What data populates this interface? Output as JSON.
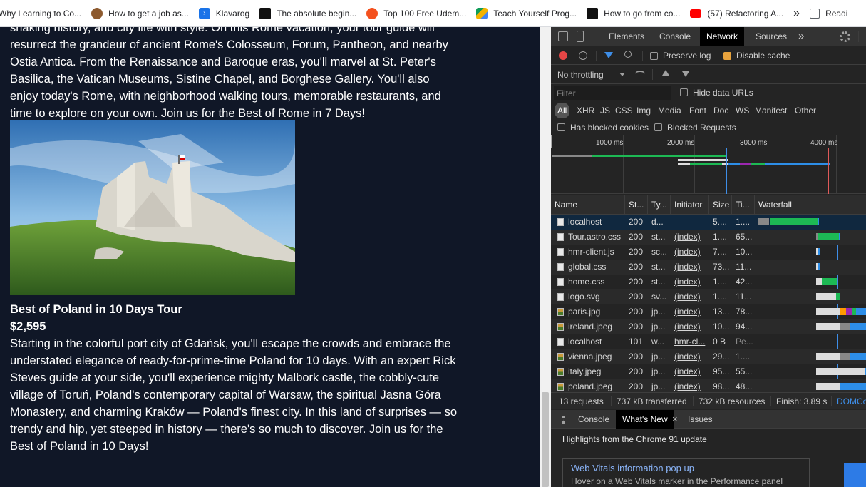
{
  "bookmarks": [
    {
      "label": "Why Learning to Co...",
      "icon": "page-icon",
      "color": "#ffffff"
    },
    {
      "label": "How to get a job as...",
      "icon": "bear-icon",
      "color": "#8d5a2e"
    },
    {
      "label": "Klavarog",
      "icon": "klavarog-icon",
      "color": "#1a73e8"
    },
    {
      "label": "The absolute begin...",
      "icon": "dev-icon",
      "color": "#111111"
    },
    {
      "label": "Top 100 Free Udem...",
      "icon": "udemy-icon",
      "color": "#f4511e"
    },
    {
      "label": "Teach Yourself Prog...",
      "icon": "google-drive-icon",
      "color": "#f4b400"
    },
    {
      "label": "How to go from co...",
      "icon": "dev-icon",
      "color": "#111111"
    },
    {
      "label": "(57) Refactoring A...",
      "icon": "youtube-icon",
      "color": "#ff0000"
    }
  ],
  "bookmarks_more": "»",
  "reading_list": "Readi",
  "page": {
    "paragraph1": "shaking history, and city life with style. On this Rome vacation, your tour guide will resurrect the grandeur of ancient Rome's Colosseum, Forum, Pantheon, and nearby Ostia Antica. From the Renaissance and Baroque eras, you'll marvel at St. Peter's Basilica, the Vatican Museums, Sistine Chapel, and Borghese Gallery. You'll also enjoy today's Rome, with neighborhood walking tours, memorable restaurants, and time to explore on your own. Join us for the Best of Rome in 7 Days!",
    "tour2_title": "Best of Poland in 10 Days Tour",
    "tour2_price": "$2,595",
    "paragraph2": "Starting in the colorful port city of Gdańsk, you'll escape the crowds and embrace the understated elegance of ready-for-prime-time Poland for 10 days. With an expert Rick Steves guide at your side, you'll experience mighty Malbork castle, the cobbly-cute village of Toruń, Poland's contemporary capital of Warsaw, the spiritual Jasna Góra Monastery, and charming Kraków — Poland's finest city. In this land of surprises — so trendy and hip, yet steeped in history — there's so much to discover. Join us for the Best of Poland in 10 Days!"
  },
  "devtools": {
    "tabs": [
      "Elements",
      "Console",
      "Network",
      "Sources"
    ],
    "active_tab": "Network",
    "more_tabs": "»",
    "preserve_log": "Preserve log",
    "disable_cache": "Disable cache",
    "throttling": "No throttling",
    "filter_placeholder": "Filter",
    "hide_data_urls": "Hide data URLs",
    "types": [
      "All",
      "XHR",
      "JS",
      "CSS",
      "Img",
      "Media",
      "Font",
      "Doc",
      "WS",
      "Manifest",
      "Other"
    ],
    "has_blocked_cookies": "Has blocked cookies",
    "blocked_requests": "Blocked Requests",
    "timeline_ticks": [
      "1000 ms",
      "2000 ms",
      "3000 ms",
      "4000 ms"
    ],
    "columns": [
      "Name",
      "St...",
      "Ty...",
      "Initiator",
      "Size",
      "Ti...",
      "Waterfall"
    ],
    "requests": [
      {
        "name": "localhost",
        "status": "200",
        "type": "d...",
        "initiator": "",
        "size": "5....",
        "time": "1....",
        "icon": "document"
      },
      {
        "name": "Tour.astro.css",
        "status": "200",
        "type": "st...",
        "initiator": "(index)",
        "size": "1....",
        "time": "65...",
        "icon": "document"
      },
      {
        "name": "hmr-client.js",
        "status": "200",
        "type": "sc...",
        "initiator": "(index)",
        "size": "7....",
        "time": "10...",
        "icon": "document"
      },
      {
        "name": "global.css",
        "status": "200",
        "type": "st...",
        "initiator": "(index)",
        "size": "73...",
        "time": "11...",
        "icon": "document"
      },
      {
        "name": "home.css",
        "status": "200",
        "type": "st...",
        "initiator": "(index)",
        "size": "1....",
        "time": "42...",
        "icon": "document"
      },
      {
        "name": "logo.svg",
        "status": "200",
        "type": "sv...",
        "initiator": "(index)",
        "size": "1....",
        "time": "11...",
        "icon": "document"
      },
      {
        "name": "paris.jpg",
        "status": "200",
        "type": "jp...",
        "initiator": "(index)",
        "size": "13...",
        "time": "78...",
        "icon": "image"
      },
      {
        "name": "ireland.jpeg",
        "status": "200",
        "type": "jp...",
        "initiator": "(index)",
        "size": "10...",
        "time": "94...",
        "icon": "image"
      },
      {
        "name": "localhost",
        "status": "101",
        "type": "w...",
        "initiator": "hmr-cl...",
        "size": "0 B",
        "time": "Pe...",
        "icon": "document"
      },
      {
        "name": "vienna.jpeg",
        "status": "200",
        "type": "jp...",
        "initiator": "(index)",
        "size": "29...",
        "time": "1....",
        "icon": "image"
      },
      {
        "name": "italy.jpeg",
        "status": "200",
        "type": "jp...",
        "initiator": "(index)",
        "size": "95...",
        "time": "55...",
        "icon": "image"
      },
      {
        "name": "poland.jpeg",
        "status": "200",
        "type": "jp...",
        "initiator": "(index)",
        "size": "98...",
        "time": "48...",
        "icon": "image"
      }
    ],
    "summary": {
      "requests": "13 requests",
      "transferred": "737 kB transferred",
      "resources": "732 kB resources",
      "finish": "Finish: 3.89 s",
      "domcontent": "DOMCo"
    },
    "drawer_tabs": [
      "Console",
      "What's New",
      "Issues"
    ],
    "drawer_active": "What's New",
    "highlights": "Highlights from the Chrome 91 update",
    "card_title": "Web Vitals information pop up",
    "card_text": "Hover on a Web Vitals marker in the Performance panel"
  }
}
